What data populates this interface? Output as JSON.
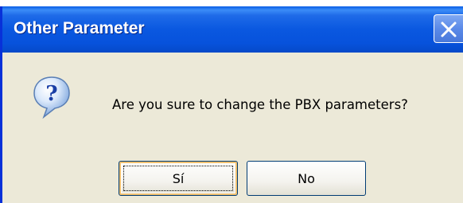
{
  "window": {
    "title": "Other Parameter"
  },
  "dialog": {
    "icon": "question-icon",
    "message": "Are you sure to change the PBX parameters?"
  },
  "buttons": {
    "yes_label": "Sí",
    "no_label": "No"
  },
  "colors": {
    "titlebar": "#0a58e0",
    "title_text": "#ffffff",
    "dialog_background": "#ece9d8",
    "button_border": "#003c74"
  }
}
